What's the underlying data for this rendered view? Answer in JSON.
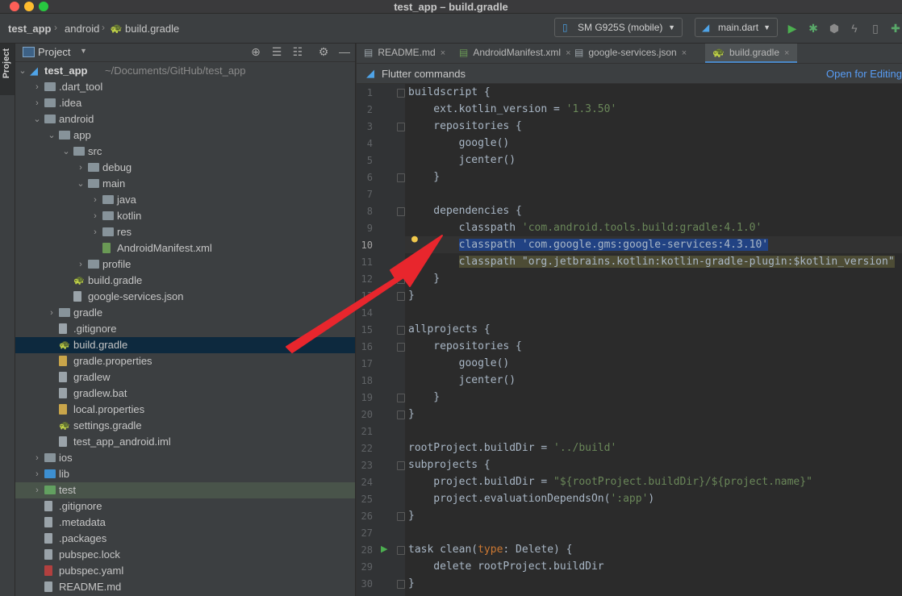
{
  "window": {
    "title": "test_app – build.gradle"
  },
  "navbar": {
    "breadcrumbs": [
      "test_app",
      "android",
      "build.gradle"
    ],
    "device": "SM G925S (mobile)",
    "run_config": "main.dart"
  },
  "sidebar_strip": {
    "label": "Project"
  },
  "project_panel": {
    "title": "Project",
    "tree": [
      {
        "label": "test_app",
        "suffix": "~/Documents/GitHub/test_app",
        "depth": 0,
        "arrow": "open",
        "icon": "flutter",
        "bold": true
      },
      {
        "label": ".dart_tool",
        "depth": 1,
        "arrow": "closed",
        "icon": "folder"
      },
      {
        "label": ".idea",
        "depth": 1,
        "arrow": "closed",
        "icon": "folder"
      },
      {
        "label": "android",
        "depth": 1,
        "arrow": "open",
        "icon": "folder"
      },
      {
        "label": "app",
        "depth": 2,
        "arrow": "open",
        "icon": "folder"
      },
      {
        "label": "src",
        "depth": 3,
        "arrow": "open",
        "icon": "folder"
      },
      {
        "label": "debug",
        "depth": 4,
        "arrow": "closed",
        "icon": "folder"
      },
      {
        "label": "main",
        "depth": 4,
        "arrow": "open",
        "icon": "folder"
      },
      {
        "label": "java",
        "depth": 5,
        "arrow": "closed",
        "icon": "folder"
      },
      {
        "label": "kotlin",
        "depth": 5,
        "arrow": "closed",
        "icon": "folder"
      },
      {
        "label": "res",
        "depth": 5,
        "arrow": "closed",
        "icon": "folder"
      },
      {
        "label": "AndroidManifest.xml",
        "depth": 5,
        "arrow": "none",
        "icon": "xml"
      },
      {
        "label": "profile",
        "depth": 4,
        "arrow": "closed",
        "icon": "folder"
      },
      {
        "label": "build.gradle",
        "depth": 3,
        "arrow": "none",
        "icon": "gradle"
      },
      {
        "label": "google-services.json",
        "depth": 3,
        "arrow": "none",
        "icon": "file"
      },
      {
        "label": "gradle",
        "depth": 2,
        "arrow": "closed",
        "icon": "folder"
      },
      {
        "label": ".gitignore",
        "depth": 2,
        "arrow": "none",
        "icon": "file"
      },
      {
        "label": "build.gradle",
        "depth": 2,
        "arrow": "none",
        "icon": "gradle",
        "selected": true
      },
      {
        "label": "gradle.properties",
        "depth": 2,
        "arrow": "none",
        "icon": "props"
      },
      {
        "label": "gradlew",
        "depth": 2,
        "arrow": "none",
        "icon": "file"
      },
      {
        "label": "gradlew.bat",
        "depth": 2,
        "arrow": "none",
        "icon": "file"
      },
      {
        "label": "local.properties",
        "depth": 2,
        "arrow": "none",
        "icon": "props"
      },
      {
        "label": "settings.gradle",
        "depth": 2,
        "arrow": "none",
        "icon": "gradle"
      },
      {
        "label": "test_app_android.iml",
        "depth": 2,
        "arrow": "none",
        "icon": "file"
      },
      {
        "label": "ios",
        "depth": 1,
        "arrow": "closed",
        "icon": "folder"
      },
      {
        "label": "lib",
        "depth": 1,
        "arrow": "closed",
        "icon": "folder-blue"
      },
      {
        "label": "test",
        "depth": 1,
        "arrow": "closed",
        "icon": "folder-green",
        "test": true
      },
      {
        "label": ".gitignore",
        "depth": 1,
        "arrow": "none",
        "icon": "file"
      },
      {
        "label": ".metadata",
        "depth": 1,
        "arrow": "none",
        "icon": "file"
      },
      {
        "label": ".packages",
        "depth": 1,
        "arrow": "none",
        "icon": "file"
      },
      {
        "label": "pubspec.lock",
        "depth": 1,
        "arrow": "none",
        "icon": "file"
      },
      {
        "label": "pubspec.yaml",
        "depth": 1,
        "arrow": "none",
        "icon": "yaml"
      },
      {
        "label": "README.md",
        "depth": 1,
        "arrow": "none",
        "icon": "file"
      }
    ]
  },
  "editor": {
    "tabs": [
      {
        "label": "README.md",
        "active": false
      },
      {
        "label": "AndroidManifest.xml",
        "active": false
      },
      {
        "label": "google-services.json",
        "active": false
      },
      {
        "label": "build.gradle",
        "active": true
      }
    ],
    "flutter_bar": {
      "label": "Flutter commands",
      "link": "Open for Editing"
    },
    "lines": [
      [
        [
          "t",
          "buildscript {"
        ]
      ],
      [
        [
          "t",
          "    ext.kotlin_version = "
        ],
        [
          "s",
          "'1.3.50'"
        ]
      ],
      [
        [
          "t",
          "    repositories {"
        ]
      ],
      [
        [
          "t",
          "        google()"
        ]
      ],
      [
        [
          "t",
          "        jcenter()"
        ]
      ],
      [
        [
          "t",
          "    }"
        ]
      ],
      [
        [
          "t",
          ""
        ]
      ],
      [
        [
          "t",
          "    dependencies {"
        ]
      ],
      [
        [
          "t",
          "        classpath "
        ],
        [
          "s",
          "'com.android.tools.build:gradle:4.1.0'"
        ]
      ],
      [
        [
          "t",
          "        "
        ],
        [
          "sel",
          "classpath 'com.google.gms:google-services:4.3.10'"
        ]
      ],
      [
        [
          "t",
          "        "
        ],
        [
          "warn",
          "classpath \"org.jetbrains.kotlin:kotlin-gradle-plugin:$kotlin_version\""
        ]
      ],
      [
        [
          "t",
          "    }"
        ]
      ],
      [
        [
          "t",
          "}"
        ]
      ],
      [
        [
          "t",
          ""
        ]
      ],
      [
        [
          "t",
          "allprojects {"
        ]
      ],
      [
        [
          "t",
          "    repositories {"
        ]
      ],
      [
        [
          "t",
          "        google()"
        ]
      ],
      [
        [
          "t",
          "        jcenter()"
        ]
      ],
      [
        [
          "t",
          "    }"
        ]
      ],
      [
        [
          "t",
          "}"
        ]
      ],
      [
        [
          "t",
          ""
        ]
      ],
      [
        [
          "t",
          "rootProject.buildDir = "
        ],
        [
          "s",
          "'../build'"
        ]
      ],
      [
        [
          "t",
          "subprojects {"
        ]
      ],
      [
        [
          "t",
          "    project.buildDir = "
        ],
        [
          "s",
          "\"${rootProject.buildDir}/${project.name}\""
        ]
      ],
      [
        [
          "t",
          "    project.evaluationDependsOn("
        ],
        [
          "s",
          "':app'"
        ],
        [
          "t",
          ")"
        ]
      ],
      [
        [
          "t",
          "}"
        ]
      ],
      [
        [
          "t",
          ""
        ]
      ],
      [
        [
          "t",
          "task clean("
        ],
        [
          "k",
          "type"
        ],
        [
          "t",
          ": Delete) {"
        ]
      ],
      [
        [
          "t",
          "    delete rootProject.buildDir"
        ]
      ],
      [
        [
          "t",
          "}"
        ]
      ]
    ],
    "current_line": 10,
    "bulb_line": 10,
    "run_line": 28,
    "fold_lines": [
      1,
      3,
      6,
      8,
      12,
      13,
      15,
      16,
      19,
      20,
      23,
      26,
      28,
      30
    ]
  },
  "colors": {
    "selection": "#214283",
    "warning_highlight": "#4d4c35",
    "annotation_arrow": "#e8262d",
    "link": "#589df6"
  }
}
